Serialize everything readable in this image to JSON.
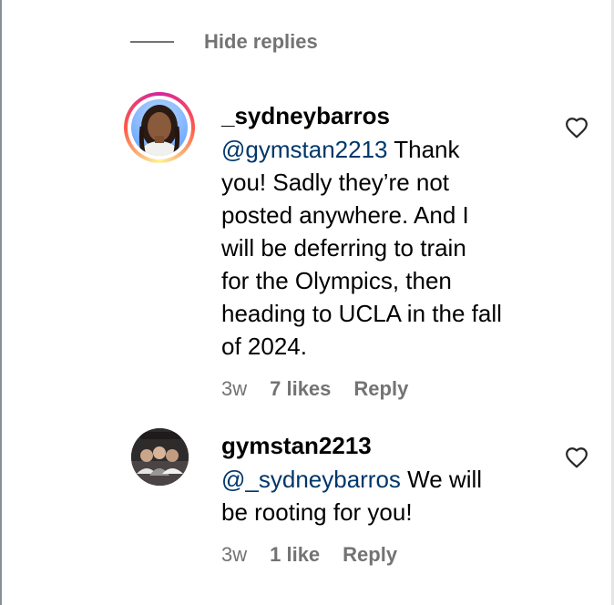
{
  "thread": {
    "hide_replies_label": "Hide replies"
  },
  "comments": [
    {
      "username": "_sydneybarros",
      "mention": "@gymstan2213",
      "text_lines": [
        " Thank",
        "you! Sadly they’re not",
        "posted anywhere. And I",
        "will be deferring to train",
        "for the Olympics, then",
        "heading to UCLA in the fall",
        "of 2024."
      ],
      "time": "3w",
      "likes": "7 likes",
      "reply_label": "Reply",
      "has_story_ring": true
    },
    {
      "username": "gymstan2213",
      "mention": "@_sydneybarros",
      "text_lines": [
        " We will",
        "be rooting for you!"
      ],
      "time": "3w",
      "likes": "1 like",
      "reply_label": "Reply",
      "has_story_ring": false
    }
  ],
  "icons": {
    "like": "heart-outline-icon"
  },
  "colors": {
    "mention": "#00376b",
    "secondary_text": "#737373",
    "story_ring": [
      "#d6249f",
      "#fd5949",
      "#fdf497"
    ]
  }
}
